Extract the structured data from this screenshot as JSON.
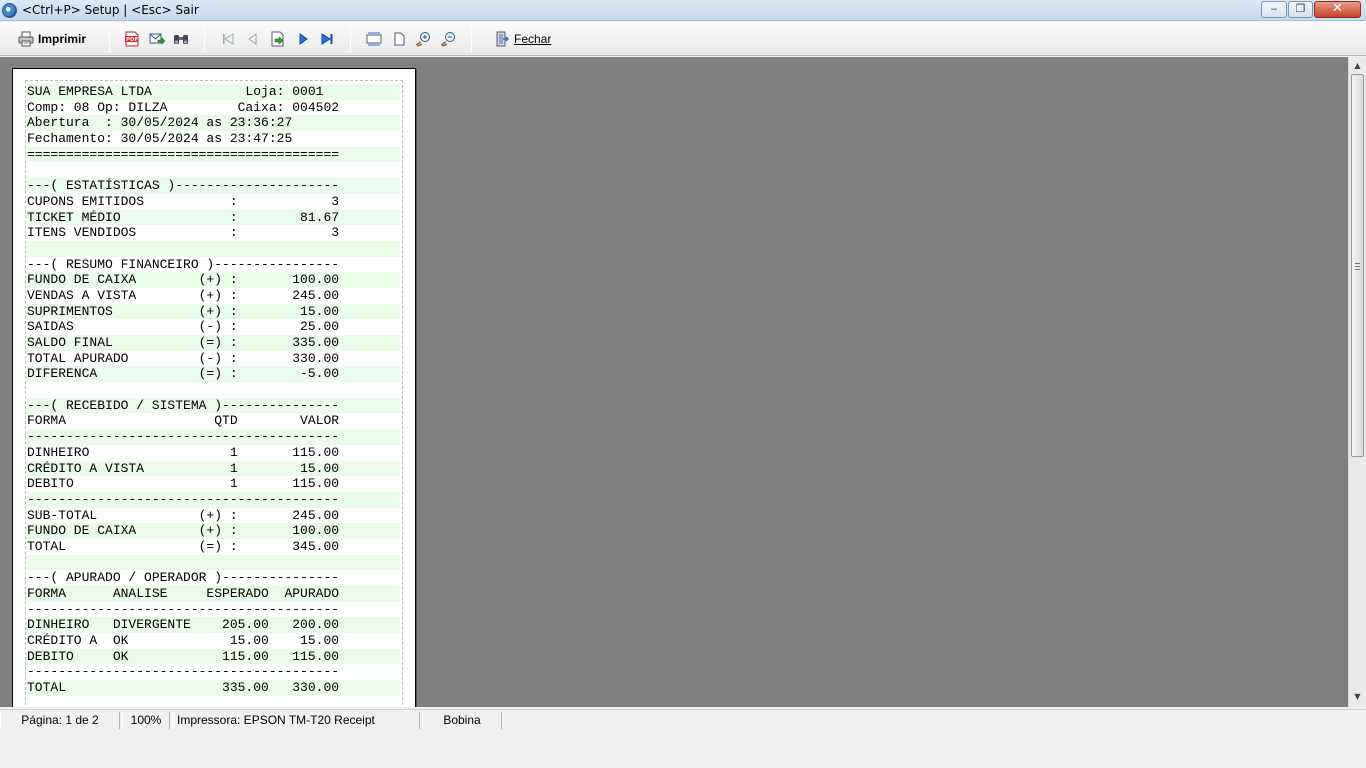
{
  "window": {
    "title": "<Ctrl+P> Setup | <Esc> Sair",
    "minimize_symbol": "‒",
    "maximize_symbol": "❐",
    "close_symbol": "✕"
  },
  "toolbar": {
    "print_label": "Imprimir",
    "close_label": "Fechar",
    "icons": [
      "printer-icon",
      "pdf-icon",
      "email-export-icon",
      "find-icon",
      "first-page-icon",
      "previous-page-icon",
      "goto-page-icon",
      "next-page-icon",
      "last-page-icon",
      "page-width-icon",
      "whole-page-icon",
      "zoom-in-icon",
      "zoom-out-icon",
      "exit-door-icon"
    ]
  },
  "receipt": {
    "lines": [
      "SUA EMPRESA LTDA            Loja: 0001",
      "Comp: 08 Op: DILZA         Caixa: 004502",
      "Abertura  : 30/05/2024 as 23:36:27",
      "Fechamento: 30/05/2024 as 23:47:25",
      "========================================",
      "",
      "---( ESTATÍSTICAS )---------------------",
      "CUPONS EMITIDOS           :            3",
      "TICKET MÉDIO              :        81.67",
      "ITENS VENDIDOS            :            3",
      "",
      "---( RESUMO FINANCEIRO )----------------",
      "FUNDO DE CAIXA        (+) :       100.00",
      "VENDAS A VISTA        (+) :       245.00",
      "SUPRIMENTOS           (+) :        15.00",
      "SAIDAS                (-) :        25.00",
      "SALDO FINAL           (=) :       335.00",
      "TOTAL APURADO         (-) :       330.00",
      "DIFERENCA             (=) :        -5.00",
      "",
      "---( RECEBIDO / SISTEMA )---------------",
      "FORMA                   QTD        VALOR",
      "----------------------------------------",
      "DINHEIRO                  1       115.00",
      "CRÉDITO A VISTA           1        15.00",
      "DEBITO                    1       115.00",
      "----------------------------------------",
      "SUB-TOTAL             (+) :       245.00",
      "FUNDO DE CAIXA        (+) :       100.00",
      "TOTAL                 (=) :       345.00",
      "",
      "---( APURADO / OPERADOR )---------------",
      "FORMA      ANALISE     ESPERADO  APURADO",
      "----------------------------------------",
      "DINHEIRO   DIVERGENTE    205.00   200.00",
      "CRÉDITO A  OK             15.00    15.00",
      "DEBITO     OK            115.00   115.00",
      "----------------------------------------",
      "TOTAL                    335.00   330.00"
    ]
  },
  "statusbar": {
    "page": "Página: 1 de 2",
    "zoom": "100%",
    "printer": "Impressora: EPSON TM-T20 Receipt",
    "paper": "Bobina"
  },
  "colors": {
    "receipt_stripe": "#eafbea",
    "workarea_bg": "#808080",
    "titlebar_bg": "#c4d8ef"
  }
}
